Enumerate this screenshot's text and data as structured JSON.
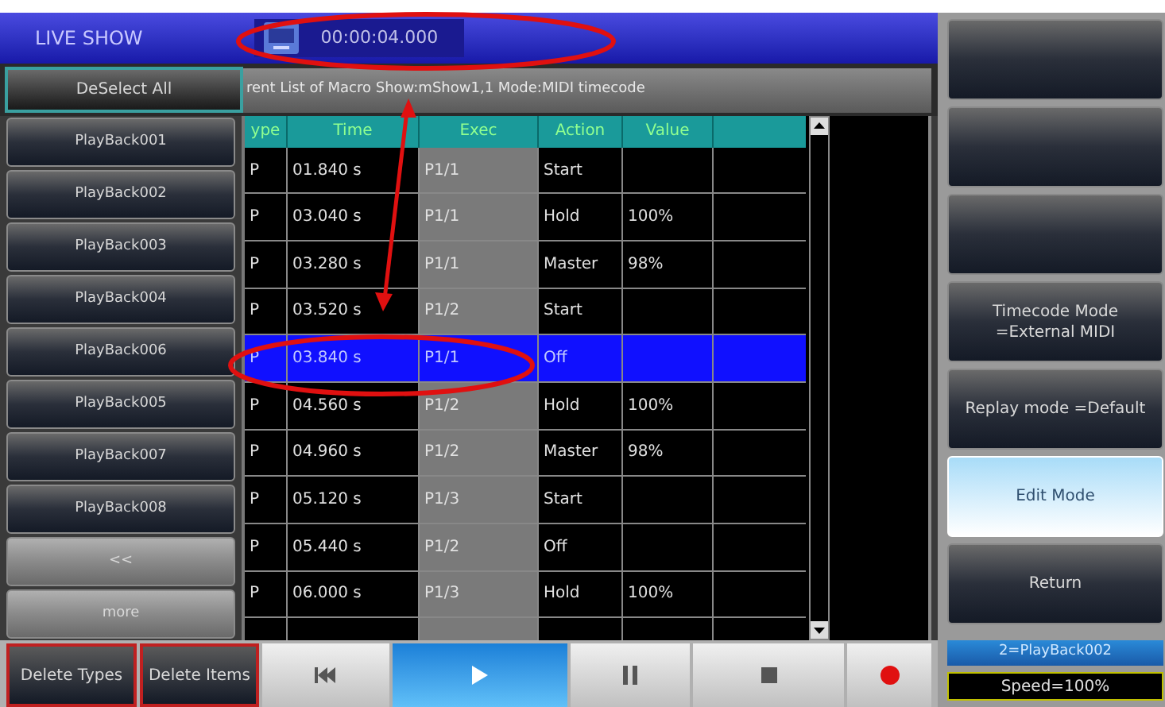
{
  "title": "LIVE SHOW",
  "clock": "00:00:04.000",
  "deselect_button": "DeSelect All",
  "info_text": "rent List of Macro Show:mShow1,1  Mode:MIDI timecode",
  "playbacks": [
    {
      "label": "PlayBack001"
    },
    {
      "label": "PlayBack002"
    },
    {
      "label": "PlayBack003"
    },
    {
      "label": "PlayBack004"
    },
    {
      "label": "PlayBack006"
    },
    {
      "label": "PlayBack005"
    },
    {
      "label": "PlayBack007"
    },
    {
      "label": "PlayBack008"
    },
    {
      "label": "<<"
    },
    {
      "label": "more"
    }
  ],
  "table": {
    "columns": [
      "ype",
      "Time",
      "Exec",
      "Action",
      "Value"
    ],
    "rows": [
      {
        "cells": [
          "P",
          "01.840 s",
          "P1/1",
          "Start",
          ""
        ],
        "selected": false
      },
      {
        "cells": [
          "P",
          "03.040 s",
          "P1/1",
          "Hold",
          "100%"
        ],
        "selected": false
      },
      {
        "cells": [
          "P",
          "03.280 s",
          "P1/1",
          "Master",
          "98%"
        ],
        "selected": false
      },
      {
        "cells": [
          "P",
          "03.520 s",
          "P1/2",
          "Start",
          ""
        ],
        "selected": false
      },
      {
        "cells": [
          "P",
          "03.840 s",
          "P1/1",
          "Off",
          ""
        ],
        "selected": true
      },
      {
        "cells": [
          "P",
          "04.560 s",
          "P1/2",
          "Hold",
          "100%"
        ],
        "selected": false
      },
      {
        "cells": [
          "P",
          "04.960 s",
          "P1/2",
          "Master",
          "98%"
        ],
        "selected": false
      },
      {
        "cells": [
          "P",
          "05.120 s",
          "P1/3",
          "Start",
          ""
        ],
        "selected": false
      },
      {
        "cells": [
          "P",
          "05.440 s",
          "P1/2",
          "Off",
          ""
        ],
        "selected": false
      },
      {
        "cells": [
          "P",
          "06.000 s",
          "P1/3",
          "Hold",
          "100%"
        ],
        "selected": false
      }
    ]
  },
  "bottom_buttons": [
    {
      "kind": "text",
      "label": "Delete Types",
      "selected": false
    },
    {
      "kind": "text",
      "label": "Delete Items",
      "selected": false
    },
    {
      "kind": "previous",
      "selected": false
    },
    {
      "kind": "play",
      "selected": true
    },
    {
      "kind": "pause",
      "selected": false
    },
    {
      "kind": "stop",
      "selected": false
    },
    {
      "kind": "record",
      "selected": false
    }
  ],
  "side_buttons": [
    {
      "selected": false
    },
    {
      "selected": false
    },
    {
      "selected": false
    },
    {
      "label": "Timecode Mode =External MIDI",
      "selected": false
    },
    {
      "label": "Replay mode =Default",
      "selected": false
    },
    {
      "label": "Edit Mode",
      "selected": true
    },
    {
      "label": "Return",
      "selected": false
    }
  ],
  "status": {
    "playback": "2=PlayBack002",
    "speed": "Speed=100%"
  }
}
